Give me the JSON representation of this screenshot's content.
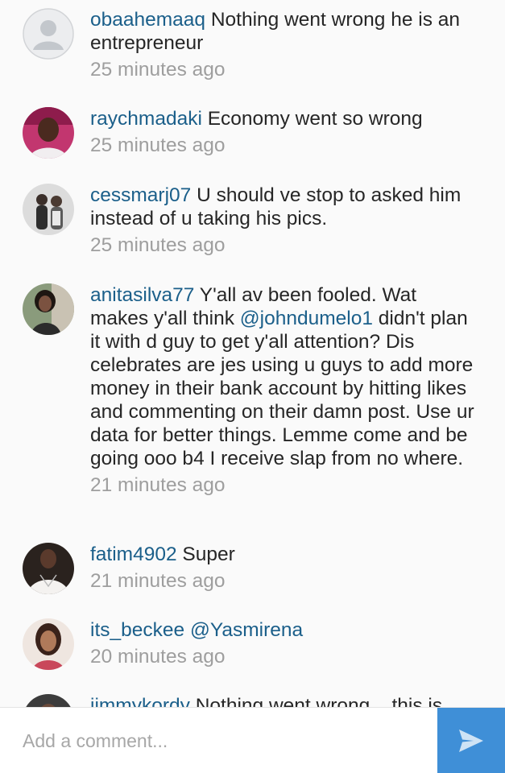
{
  "comments": [
    {
      "username": "obaahemaaq",
      "text": "Nothing went wrong he is an entrepreneur",
      "time": "25 minutes ago"
    },
    {
      "username": "raychmadaki",
      "text": "Economy went so wrong",
      "time": "25 minutes ago"
    },
    {
      "username": "cessmarj07",
      "text": "U should ve stop to asked him instead of u taking his pics.",
      "time": "25 minutes ago"
    },
    {
      "username": "anitasilva77",
      "text_before": "Y'all av been fooled. Wat makes y'all think ",
      "mention": "@johndumelo1",
      "text_after": " didn't plan it with d guy to get y'all attention? Dis celebrates are jes using u guys to add more money in their bank account by hitting likes and commenting on their damn post. Use ur data for better things. Lemme come and be going ooo b4 I receive slap from no where.",
      "time": "21 minutes ago"
    },
    {
      "username": "fatim4902",
      "text": "Super",
      "time": "21 minutes ago"
    },
    {
      "username": "its_beckee",
      "mention": "@Yasmirena",
      "time": "20 minutes ago"
    },
    {
      "username": "jimmykordy",
      "text": "Nothing went wrong .. this is"
    }
  ],
  "composer": {
    "placeholder": "Add a comment...",
    "send_icon": "send-arrow-icon"
  },
  "colors": {
    "username": "#1b5f8a",
    "timestamp": "#9e9e9e",
    "send_button": "#3f8fd7",
    "background": "#fafafa"
  }
}
